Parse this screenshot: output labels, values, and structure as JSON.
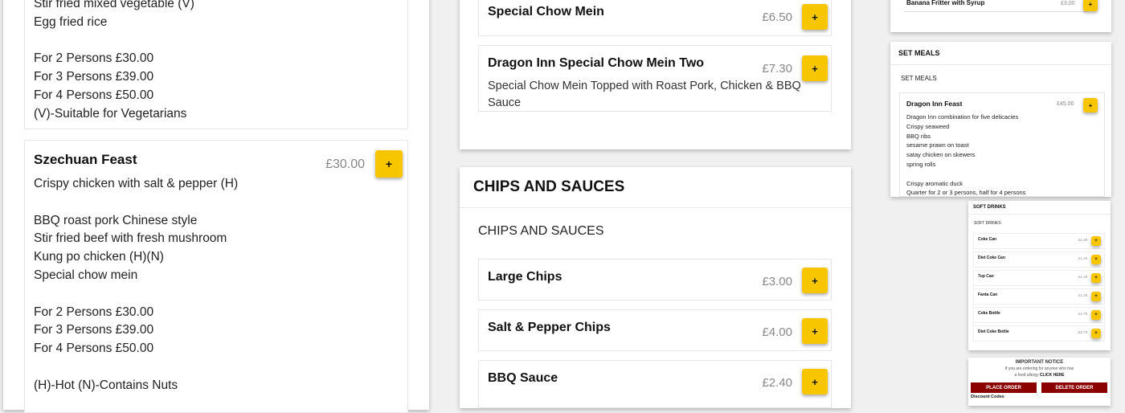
{
  "left": {
    "top_lines": [
      "Stir fried mixed vegetable (V)",
      "Egg fried rice",
      "",
      "For 2 Persons £30.00",
      "For 3 Persons £39.00",
      "For 4 Persons £50.00",
      "(V)-Suitable for Vegetarians"
    ],
    "szechuan": {
      "name": "Szechuan Feast",
      "price": "£30.00",
      "lines": [
        "Crispy chicken with salt & pepper (H)",
        "",
        "BBQ roast pork Chinese style",
        "Stir fried beef with fresh mushroom",
        "Kung po chicken (H)(N)",
        "Special chow mein",
        "",
        "For 2 Persons £30.00",
        "For 3 Persons £39.00",
        "For 4 Persons £50.00",
        "",
        "(H)-Hot (N)-Contains Nuts"
      ]
    }
  },
  "middle": {
    "special_chow_mein": {
      "name": "Special Chow Mein",
      "price": "£6.50"
    },
    "dragon_inn_two": {
      "name": "Dragon Inn Special Chow Mein Two",
      "price": "£7.30",
      "desc": "Special Chow Mein Topped with Roast Pork, Chicken & BBQ Sauce"
    },
    "chips": {
      "title": "CHIPS AND SAUCES",
      "subtitle": "CHIPS AND SAUCES",
      "items": [
        {
          "name": "Large Chips",
          "price": "£3.00"
        },
        {
          "name": "Salt & Pepper Chips",
          "price": "£4.00"
        },
        {
          "name": "BBQ Sauce",
          "price": "£2.40"
        }
      ]
    }
  },
  "right": {
    "banana": {
      "name": "Banana Fritter with Syrup",
      "price": "£3.00"
    },
    "set_meals": {
      "title": "SET MEALS",
      "subtitle": "SET MEALS",
      "item_name": "Dragon Inn Feast",
      "item_price": "£45.00",
      "lines": [
        "Dragon Inn combination for five delicacies",
        "Crispy seaweed",
        "BBQ ribs",
        "sesame prawn on toast",
        "satay chicken on skewers",
        "spring rolls",
        "",
        "Crispy aromatic duck",
        "Quarter for 2 or 3 persons, half for 4 persons"
      ]
    },
    "soft_drinks": {
      "title": "SOFT DRINKS",
      "subtitle": "SOFT DRINKS",
      "items": [
        {
          "name": "Coke Can",
          "price": "£1.40"
        },
        {
          "name": "Diet Coke Can",
          "price": "£1.40"
        },
        {
          "name": "7up Can",
          "price": "£1.40"
        },
        {
          "name": "Fanta Can",
          "price": "£1.40"
        },
        {
          "name": "Coke Bottle",
          "price": "£2.70"
        },
        {
          "name": "Diet Coke Bottle",
          "price": "£2.70"
        }
      ]
    },
    "notice": {
      "title": "IMPORTANT NOTICE",
      "line1": "If you are ordering for anyone who has",
      "line2": "a food allergy",
      "click_here": "CLICK HERE",
      "place_order": "PLACE ORDER",
      "delete_order": "DELETE ORDER",
      "discount": "Discount Codes"
    }
  },
  "add_symbol": "+",
  "colors": {
    "accent": "#f7c600",
    "order_button": "#8b0000"
  }
}
